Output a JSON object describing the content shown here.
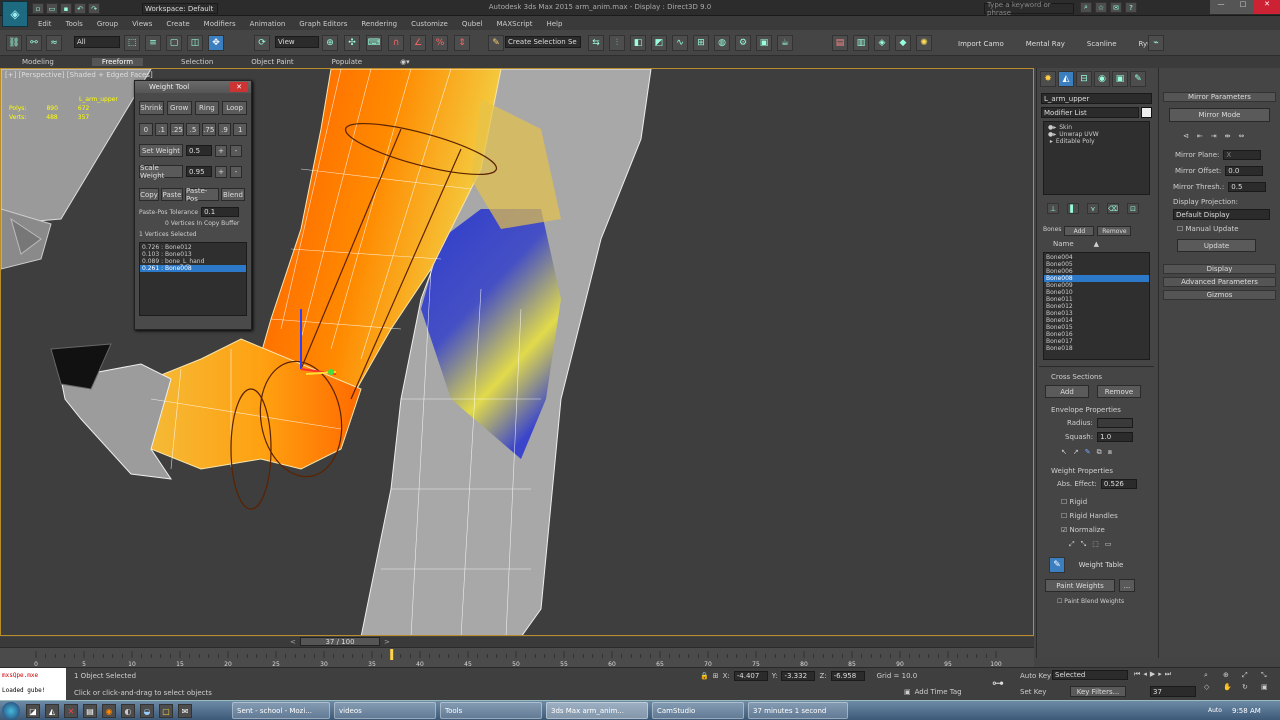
{
  "app": {
    "title": "Autodesk 3ds Max 2015  arm_anim.max - Display : Direct3D 9.0",
    "workspace": "Workspace: Default",
    "search_placeholder": "Type a keyword or phrase"
  },
  "menu": [
    "Edit",
    "Tools",
    "Group",
    "Views",
    "Create",
    "Modifiers",
    "Animation",
    "Graph Editors",
    "Rendering",
    "Customize",
    "Qubel",
    "MAXScript",
    "Help"
  ],
  "toolbar": {
    "selection_filter": "All",
    "coord_system": "View",
    "named_selection": "Create Selection Se",
    "right_labels": [
      "Import Camo",
      "Mental Ray",
      "Scanline",
      "Ryu"
    ]
  },
  "ribbon": [
    "Modeling",
    "Freeform",
    "Selection",
    "Object Paint",
    "Populate"
  ],
  "viewport": {
    "label": "[+] [Perspective] [Shaded + Edged Faces]",
    "stats": [
      {
        "label": "Polys:",
        "a": "890",
        "b": "672"
      },
      {
        "label": "Total",
        "a": "",
        "b": ""
      },
      {
        "label": "Verts:",
        "a": "488",
        "b": "357"
      }
    ],
    "stats_header": "L_arm_upper"
  },
  "weight_tool": {
    "title": "Weight Tool",
    "row1": [
      "Shrink",
      "Grow",
      "Ring",
      "Loop"
    ],
    "row2": [
      "0",
      ".1",
      ".25",
      ".5",
      ".75",
      ".9",
      "1"
    ],
    "set_weight_label": "Set Weight",
    "set_weight_value": "0.5",
    "scale_weight_label": "Scale Weight",
    "scale_weight_value": "0.95",
    "row3": [
      "Copy",
      "Paste",
      "Paste-Pos",
      "Blend"
    ],
    "paste_tol_label": "Paste-Pos Tolerance",
    "paste_tol_value": "0.1",
    "copy_buffer": "0 Vertices In Copy Buffer",
    "vertices_selected": "1 Vertices Selected",
    "bones": [
      "0.726 : Bone012",
      "0.103 : Bone013",
      "0.089 : bone_L_hand",
      "0.261 : Bone008"
    ]
  },
  "command_panel": {
    "object_name": "L_arm_upper",
    "modifier_list": "Modifier List",
    "stack": [
      "Skin",
      "Unwrap UVW",
      "Editable Poly"
    ],
    "tabs": [
      "Bones",
      "Add",
      "Remove"
    ],
    "name_header": "Name",
    "bones": [
      "Bone004",
      "Bone005",
      "Bone006",
      "Bone008",
      "Bone009",
      "Bone010",
      "Bone011",
      "Bone012",
      "Bone013",
      "Bone014",
      "Bone015",
      "Bone016",
      "Bone017",
      "Bone018"
    ],
    "selected_bone_index": 3,
    "cross_sections": "Cross Sections",
    "add": "Add",
    "remove": "Remove",
    "envelope_props": "Envelope Properties",
    "radius": "Radius:",
    "squash": "Squash:",
    "squash_value": "1.0",
    "weight_props": "Weight Properties",
    "abs_effect": "Abs. Effect:",
    "abs_effect_value": "0.526",
    "rigid": "Rigid",
    "rigid_handles": "Rigid Handles",
    "normalize": "Normalize",
    "weight_table": "Weight Table",
    "paint_weights": "Paint Weights",
    "paint_blend": "Paint Blend Weights"
  },
  "mirror_panel": {
    "header": "Mirror Parameters",
    "mirror_mode": "Mirror Mode",
    "mirror_plane": "Mirror Plane:",
    "mirror_plane_value": "X",
    "mirror_offset": "Mirror Offset:",
    "mirror_offset_value": "0.0",
    "mirror_thresh": "Mirror Thresh.:",
    "mirror_thresh_value": "0.5",
    "display_projection": "Display Projection:",
    "display_projection_value": "Default Display",
    "manual_update": "Manual Update",
    "update": "Update",
    "rollouts": [
      "Display",
      "Advanced Parameters",
      "Gizmos"
    ]
  },
  "timeline": {
    "frame": "37 / 100",
    "ticks": [
      "0",
      "5",
      "10",
      "15",
      "20",
      "25",
      "30",
      "35",
      "40",
      "45",
      "50",
      "55",
      "60",
      "65",
      "70",
      "75",
      "80",
      "85",
      "90",
      "95",
      "100"
    ],
    "current_frame": 37
  },
  "status": {
    "script_lines": [
      "mxsQpe.mxe",
      "Loaded gube!"
    ],
    "selected": "1 Object Selected",
    "hint": "Click or click-and-drag to select objects",
    "x": "-4.407",
    "y": "-3.332",
    "z": "-6.958",
    "grid": "Grid = 10.0",
    "add_time_tag": "Add Time Tag",
    "auto_key": "Auto Key",
    "set_key": "Set Key",
    "selected_dropdown": "Selected",
    "key_filters": "Key Filters...",
    "frame_field": "37"
  },
  "taskbar": {
    "items": [
      "Sent - school - Mozi...",
      "videos",
      "Tools",
      "3ds Max arm_anim...",
      "CamStudio",
      "37 minutes 1 second"
    ],
    "time": "9:58 AM",
    "lang": "Auto"
  }
}
